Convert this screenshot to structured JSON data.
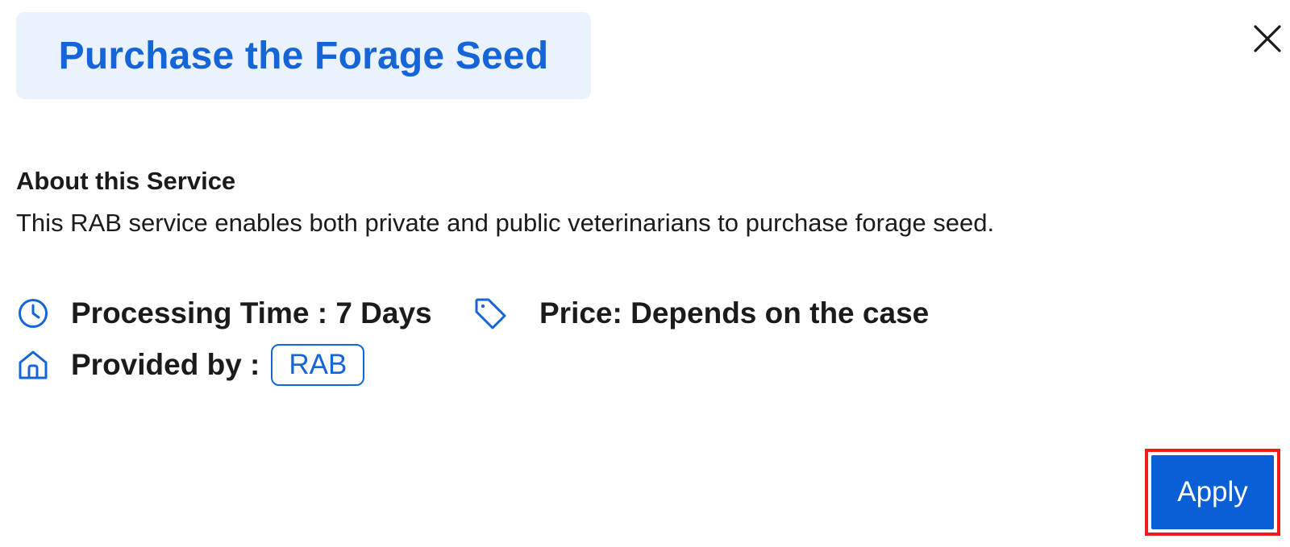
{
  "dialog": {
    "title": "Purchase the Forage Seed",
    "close_icon": "close-icon"
  },
  "about": {
    "heading": "About this Service",
    "description": "This RAB service enables both private and public veterinarians to purchase forage seed."
  },
  "meta": {
    "processing_time": "Processing Time : 7 Days",
    "processing_icon": "clock-icon",
    "price": "Price: Depends on the case",
    "price_icon": "tag-icon",
    "provided_by_label": "Provided by :",
    "provided_by_icon": "home-icon",
    "provider": "RAB"
  },
  "actions": {
    "apply_label": "Apply"
  },
  "colors": {
    "accent": "#1565d8",
    "title_bg": "#eaf2fd",
    "button_bg": "#0a5fd6",
    "highlight": "#ee1c1c"
  }
}
